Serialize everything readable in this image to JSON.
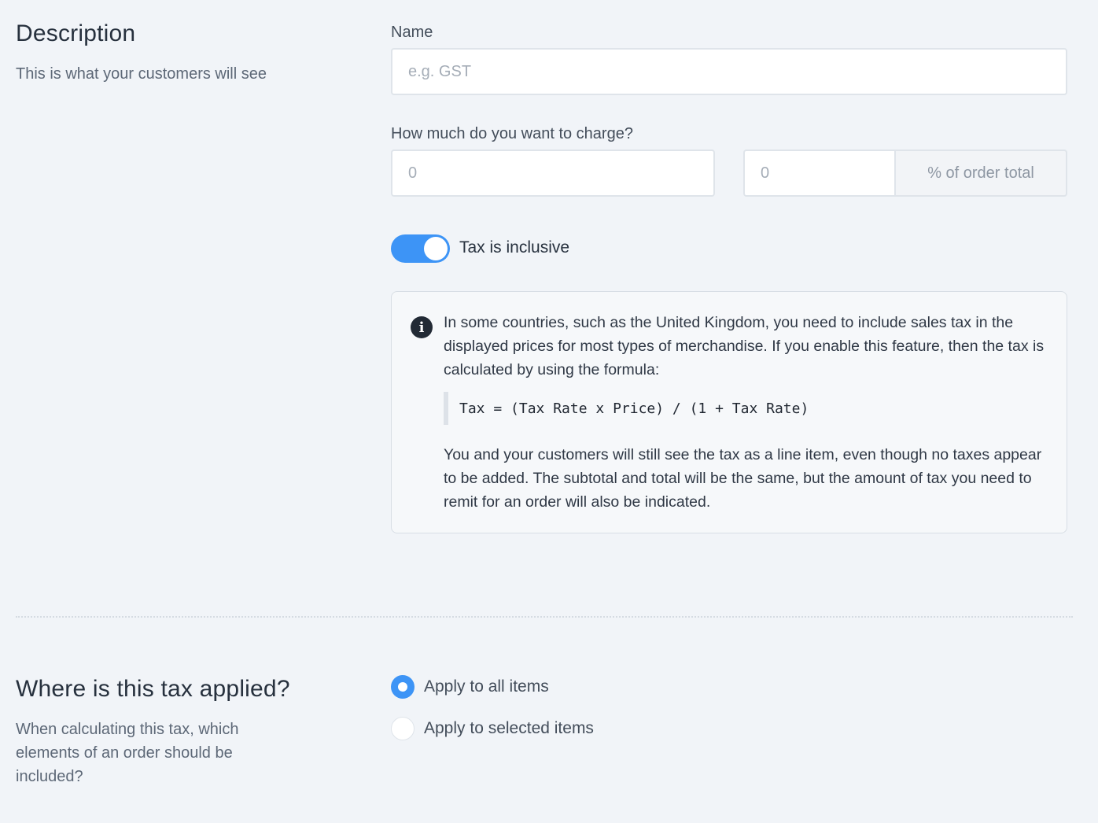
{
  "description_section": {
    "title": "Description",
    "subtitle": "This is what your customers will see"
  },
  "name_field": {
    "label": "Name",
    "value": "",
    "placeholder": "e.g. GST"
  },
  "charge_field": {
    "label": "How much do you want to charge?",
    "amount_value": "",
    "amount_placeholder": "0",
    "percent_value": "",
    "percent_placeholder": "0",
    "percent_suffix": "% of order total"
  },
  "inclusive_toggle": {
    "label": "Tax is inclusive",
    "enabled": true,
    "color": "#3d94f6"
  },
  "info_box": {
    "icon": "info-icon",
    "paragraph_1": "In some countries, such as the United Kingdom, you need to include sales tax in the displayed prices for most types of merchandise. If you enable this feature, then the tax is calculated by using the formula:",
    "formula": "Tax = (Tax Rate x Price) / (1 + Tax Rate)",
    "paragraph_2": "You and your customers will still see the tax as a line item, even though no taxes appear to be added. The subtotal and total will be the same, but the amount of tax you need to remit for an order will also be indicated."
  },
  "applied_section": {
    "title": "Where is this tax applied?",
    "subtitle": "When calculating this tax, which elements of an order should be included?",
    "options": [
      {
        "label": "Apply to all items",
        "selected": true
      },
      {
        "label": "Apply to selected items",
        "selected": false
      }
    ]
  },
  "colors": {
    "accent": "#3d94f6",
    "background": "#f1f4f8"
  }
}
